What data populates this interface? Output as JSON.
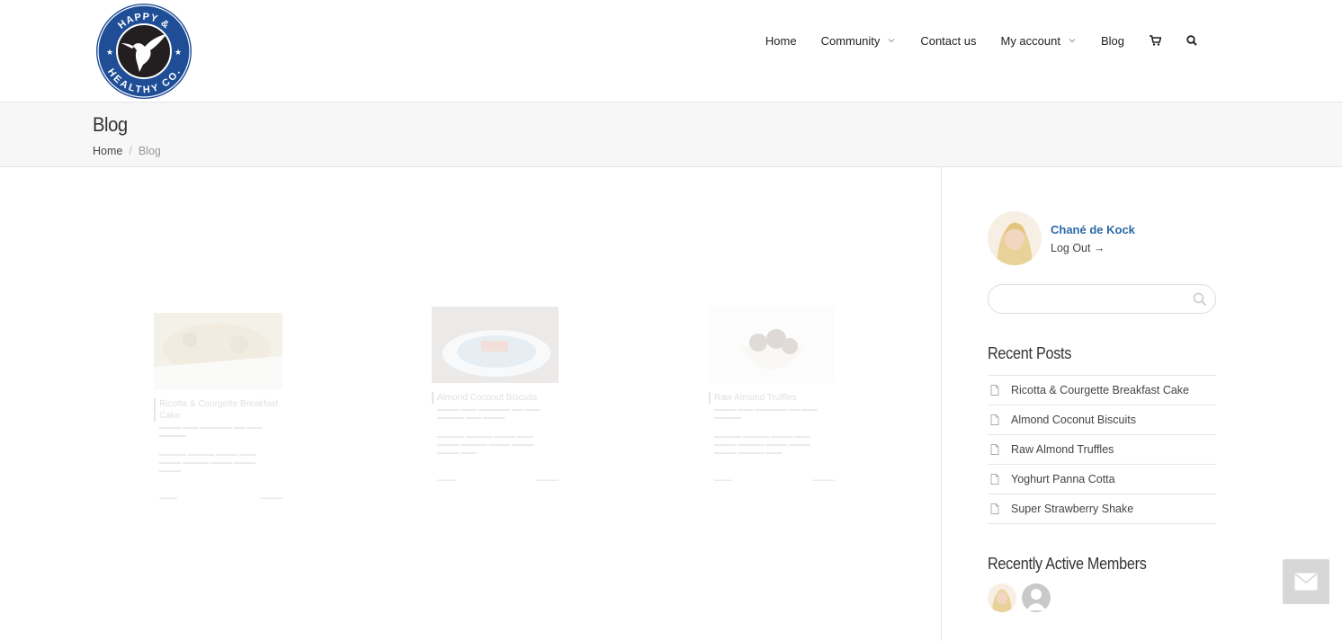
{
  "logo": {
    "text_top": "HAPPY &",
    "text_bottom": "HEALTHY CO.",
    "brand_color": "#1f4e96"
  },
  "nav": {
    "items": [
      {
        "label": "Home",
        "dropdown": false
      },
      {
        "label": "Community",
        "dropdown": true
      },
      {
        "label": "Contact us",
        "dropdown": false
      },
      {
        "label": "My account",
        "dropdown": true
      },
      {
        "label": "Blog",
        "dropdown": false
      }
    ],
    "icons": [
      "cart-icon",
      "search-icon"
    ]
  },
  "titlebar": {
    "title": "Blog",
    "breadcrumb": {
      "home": "Home",
      "separator": "/",
      "current": "Blog"
    }
  },
  "posts": [
    {
      "title": "Ricotta & Courgette Breakfast Cake"
    },
    {
      "title": "Almond Coconut Biscuits"
    },
    {
      "title": "Raw Almond Truffles"
    }
  ],
  "sidebar": {
    "user": {
      "name": "Chané de Kock",
      "logout": "Log Out →"
    },
    "search": {
      "placeholder": ""
    },
    "recent_posts": {
      "title": "Recent Posts",
      "items": [
        "Ricotta & Courgette Breakfast Cake",
        "Almond Coconut Biscuits",
        "Raw Almond Truffles",
        "Yoghurt Panna Cotta",
        "Super Strawberry Shake"
      ]
    },
    "active_members": {
      "title": "Recently Active Members"
    }
  },
  "colors": {
    "accent_link": "#2a6aa5",
    "titlebar_bg": "#f7f7f7",
    "contact_button_bg": "#d7d7d7"
  }
}
